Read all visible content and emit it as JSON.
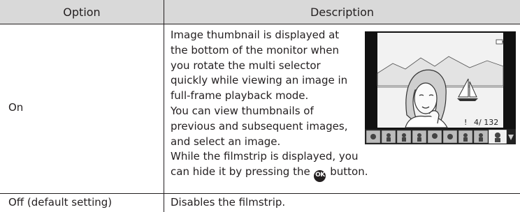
{
  "header": {
    "option_label": "Option",
    "description_label": "Description"
  },
  "rows": [
    {
      "option": "On",
      "description_lines": [
        "Image thumbnail is displayed at",
        "the bottom of the monitor when",
        "you rotate the multi selector",
        "quickly while viewing an image in",
        "full-frame playback mode.",
        "You can view thumbnails of",
        "previous and subsequent images,",
        "and select an image.",
        "While the filmstrip is displayed, you"
      ],
      "last_line_before": "can hide it by pressing the",
      "ok_glyph": "OK",
      "last_line_after": "button.",
      "screen_counter": "4/   132"
    },
    {
      "option": "Off (default setting)",
      "description": "Disables the filmstrip."
    }
  ]
}
